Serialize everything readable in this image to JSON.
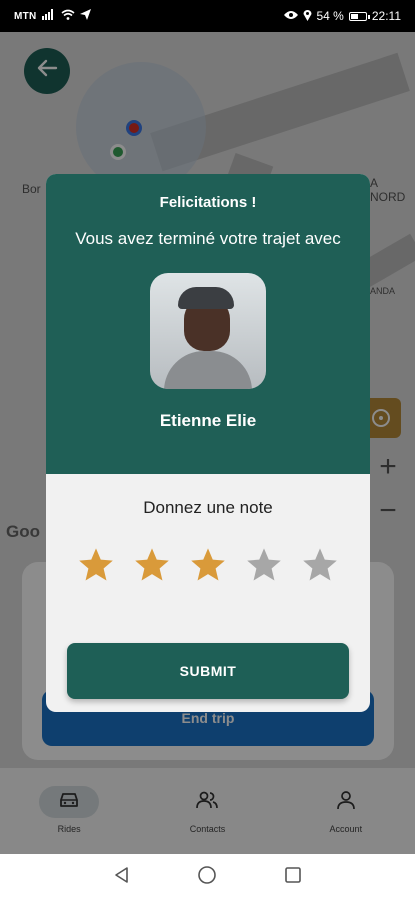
{
  "status_bar": {
    "carrier": "MTN",
    "battery": "54 %",
    "battery_level": 0.54,
    "time": "22:11"
  },
  "map": {
    "labels": [
      "Bor",
      "A NORD",
      "ANDA",
      "Goo"
    ],
    "zoom_in": "+",
    "zoom_out": "−"
  },
  "background_card": {
    "end_trip_label": "End trip"
  },
  "bottom_nav": {
    "items": [
      {
        "label": "Rides",
        "icon": "car-icon",
        "active": true
      },
      {
        "label": "Contacts",
        "icon": "contacts-icon",
        "active": false
      },
      {
        "label": "Account",
        "icon": "account-icon",
        "active": false
      }
    ]
  },
  "modal": {
    "congrats": "Felicitations !",
    "subtitle": "Vous avez terminé votre trajet avec",
    "driver_name": "Etienne Elie",
    "rate_label": "Donnez une note",
    "rating": 3,
    "max_rating": 5,
    "submit_label": "SUBMIT"
  },
  "colors": {
    "primary": "#1e5f56",
    "star_filled": "#d99a3a",
    "star_empty": "#a7a7a7"
  }
}
